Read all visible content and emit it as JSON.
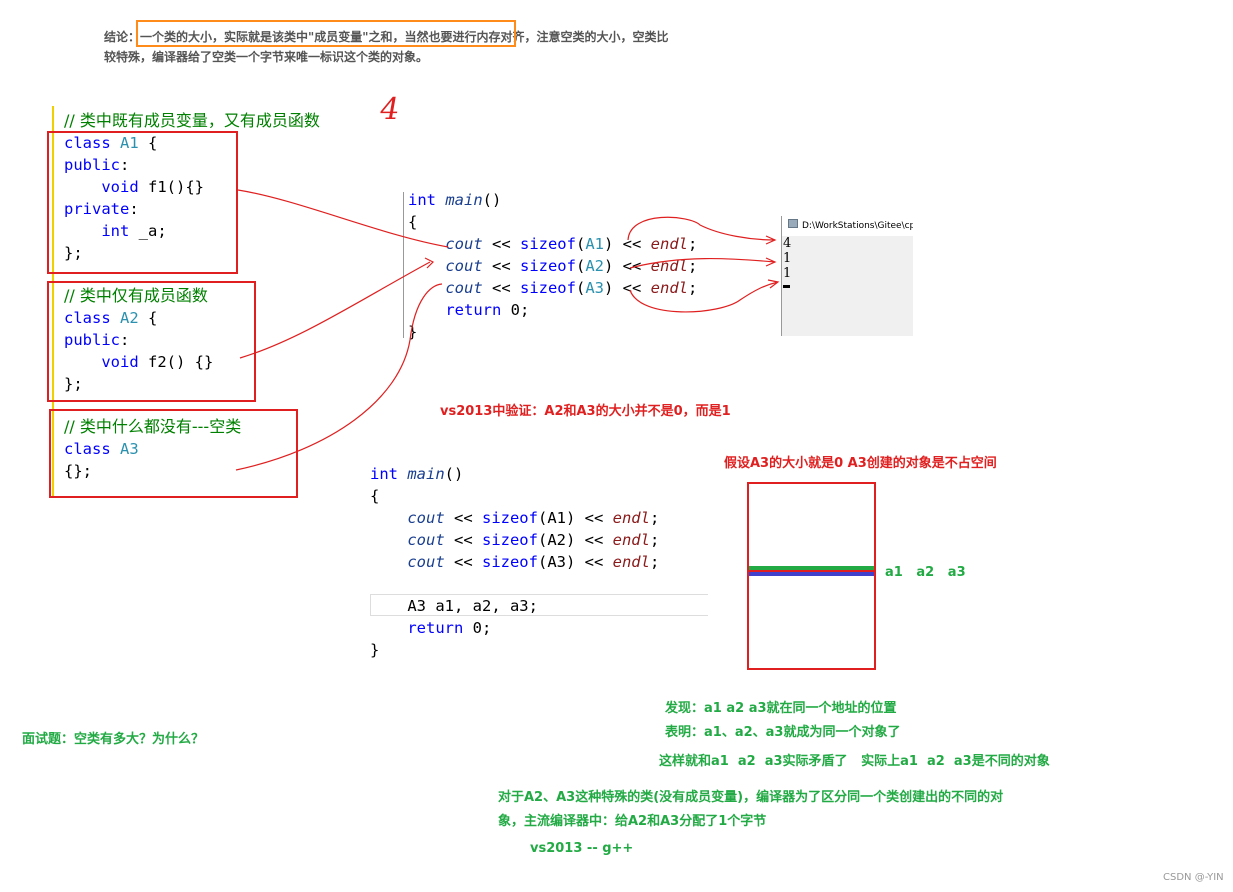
{
  "conclusion": {
    "label": "结论：",
    "highlight": "一个类的大小，实际就是该类中\"成员变量\"之和，当然也要进行内存对齐，",
    "rest1": "注意空类的大小，空类比",
    "line2": "较特殊，编译器给了空类一个字节来唯一标识这个类的对象。",
    "highlight_color": "#ff8c1a"
  },
  "handwritten_note": "4",
  "class_code": {
    "comment1": "// 类中既有成员变量，又有成员函数",
    "block1": [
      [
        {
          "k": "kw",
          "t": "class "
        },
        {
          "k": "ty",
          "t": "A1"
        },
        {
          "k": "pl",
          "t": " {"
        }
      ],
      [
        {
          "k": "kw",
          "t": "public"
        },
        {
          "k": "pl",
          "t": ":"
        }
      ],
      [
        {
          "k": "pl",
          "t": "    "
        },
        {
          "k": "kw",
          "t": "void"
        },
        {
          "k": "pl",
          "t": " f1(){}"
        }
      ],
      [
        {
          "k": "kw",
          "t": "private"
        },
        {
          "k": "pl",
          "t": ":"
        }
      ],
      [
        {
          "k": "pl",
          "t": "    "
        },
        {
          "k": "kw",
          "t": "int"
        },
        {
          "k": "pl",
          "t": " _a;"
        }
      ],
      [
        {
          "k": "pl",
          "t": "};"
        }
      ]
    ],
    "comment2": "// 类中仅有成员函数",
    "block2": [
      [
        {
          "k": "kw",
          "t": "class "
        },
        {
          "k": "ty",
          "t": "A2"
        },
        {
          "k": "pl",
          "t": " {"
        }
      ],
      [
        {
          "k": "kw",
          "t": "public"
        },
        {
          "k": "pl",
          "t": ":"
        }
      ],
      [
        {
          "k": "pl",
          "t": "    "
        },
        {
          "k": "kw",
          "t": "void"
        },
        {
          "k": "pl",
          "t": " f2() {}"
        }
      ],
      [
        {
          "k": "pl",
          "t": "};"
        }
      ]
    ],
    "comment3": "// 类中什么都没有---空类",
    "block3": [
      [
        {
          "k": "kw",
          "t": "class "
        },
        {
          "k": "ty",
          "t": "A3"
        }
      ],
      [
        {
          "k": "pl",
          "t": "{};"
        }
      ]
    ]
  },
  "main1": [
    [
      {
        "k": "kw",
        "t": "int"
      },
      {
        "k": "pl",
        "t": " "
      },
      {
        "k": "it",
        "t": "main"
      },
      {
        "k": "pl",
        "t": "()"
      }
    ],
    [
      {
        "k": "pl",
        "t": "{"
      }
    ],
    [
      {
        "k": "pl",
        "t": "    "
      },
      {
        "k": "it",
        "t": "cout"
      },
      {
        "k": "pl",
        "t": " << "
      },
      {
        "k": "kw",
        "t": "sizeof"
      },
      {
        "k": "pl",
        "t": "("
      },
      {
        "k": "ty",
        "t": "A1"
      },
      {
        "k": "pl",
        "t": ") << "
      },
      {
        "k": "el",
        "t": "endl"
      },
      {
        "k": "pl",
        "t": ";"
      }
    ],
    [
      {
        "k": "pl",
        "t": "    "
      },
      {
        "k": "it",
        "t": "cout"
      },
      {
        "k": "pl",
        "t": " << "
      },
      {
        "k": "kw",
        "t": "sizeof"
      },
      {
        "k": "pl",
        "t": "("
      },
      {
        "k": "ty",
        "t": "A2"
      },
      {
        "k": "pl",
        "t": ") << "
      },
      {
        "k": "el",
        "t": "endl"
      },
      {
        "k": "pl",
        "t": ";"
      }
    ],
    [
      {
        "k": "pl",
        "t": "    "
      },
      {
        "k": "it",
        "t": "cout"
      },
      {
        "k": "pl",
        "t": " << "
      },
      {
        "k": "kw",
        "t": "sizeof"
      },
      {
        "k": "pl",
        "t": "("
      },
      {
        "k": "ty",
        "t": "A3"
      },
      {
        "k": "pl",
        "t": ") << "
      },
      {
        "k": "el",
        "t": "endl"
      },
      {
        "k": "pl",
        "t": ";"
      }
    ],
    [
      {
        "k": "pl",
        "t": "    "
      },
      {
        "k": "kw",
        "t": "return"
      },
      {
        "k": "pl",
        "t": " 0;"
      }
    ],
    [
      {
        "k": "pl",
        "t": "}"
      }
    ]
  ],
  "console": {
    "title": "D:\\WorkStations\\Gitee\\cp",
    "output": [
      "4",
      "1",
      "1"
    ]
  },
  "verify_note": "vs2013中验证：A2和A3的大小并不是0，而是1",
  "main2": [
    [
      {
        "k": "kw",
        "t": "int"
      },
      {
        "k": "pl",
        "t": " "
      },
      {
        "k": "it",
        "t": "main"
      },
      {
        "k": "pl",
        "t": "()"
      }
    ],
    [
      {
        "k": "pl",
        "t": "{"
      }
    ],
    [
      {
        "k": "pl",
        "t": "    "
      },
      {
        "k": "it",
        "t": "cout"
      },
      {
        "k": "pl",
        "t": " << "
      },
      {
        "k": "kw",
        "t": "sizeof"
      },
      {
        "k": "pl",
        "t": "(A1) << "
      },
      {
        "k": "el",
        "t": "endl"
      },
      {
        "k": "pl",
        "t": ";"
      }
    ],
    [
      {
        "k": "pl",
        "t": "    "
      },
      {
        "k": "it",
        "t": "cout"
      },
      {
        "k": "pl",
        "t": " << "
      },
      {
        "k": "kw",
        "t": "sizeof"
      },
      {
        "k": "pl",
        "t": "(A2) << "
      },
      {
        "k": "el",
        "t": "endl"
      },
      {
        "k": "pl",
        "t": ";"
      }
    ],
    [
      {
        "k": "pl",
        "t": "    "
      },
      {
        "k": "it",
        "t": "cout"
      },
      {
        "k": "pl",
        "t": " << "
      },
      {
        "k": "kw",
        "t": "sizeof"
      },
      {
        "k": "pl",
        "t": "(A3) << "
      },
      {
        "k": "el",
        "t": "endl"
      },
      {
        "k": "pl",
        "t": ";"
      }
    ],
    [
      {
        "k": "pl",
        "t": ""
      }
    ],
    [
      {
        "k": "pl",
        "t": "    A3 a1, a2, a3;"
      }
    ],
    [
      {
        "k": "pl",
        "t": "    "
      },
      {
        "k": "kw",
        "t": "return"
      },
      {
        "k": "pl",
        "t": " 0;"
      }
    ],
    [
      {
        "k": "pl",
        "t": "}"
      }
    ]
  ],
  "memory": {
    "assumption": "假设A3的大小就是0   A3创建的对象是不占空间",
    "labels": "a1   a2   a3"
  },
  "interview_question": "面试题：空类有多大？为什么？",
  "findings": {
    "found": "发现：a1  a2  a3就在同一个地址的位置",
    "shows": "表明：a1、a2、a3就成为同一个对象了",
    "contradiction": "这样就和a1  a2  a3实际矛盾了   实际上a1  a2  a3是不同的对象",
    "explain1": "对于A2、A3这种特殊的类(没有成员变量)，编译器为了区分同一个类创建出的不同的对",
    "explain2": "象，主流编译器中：给A2和A3分配了1个字节",
    "compilers": "vs2013 -- g++"
  },
  "watermark": "CSDN @-YIN"
}
